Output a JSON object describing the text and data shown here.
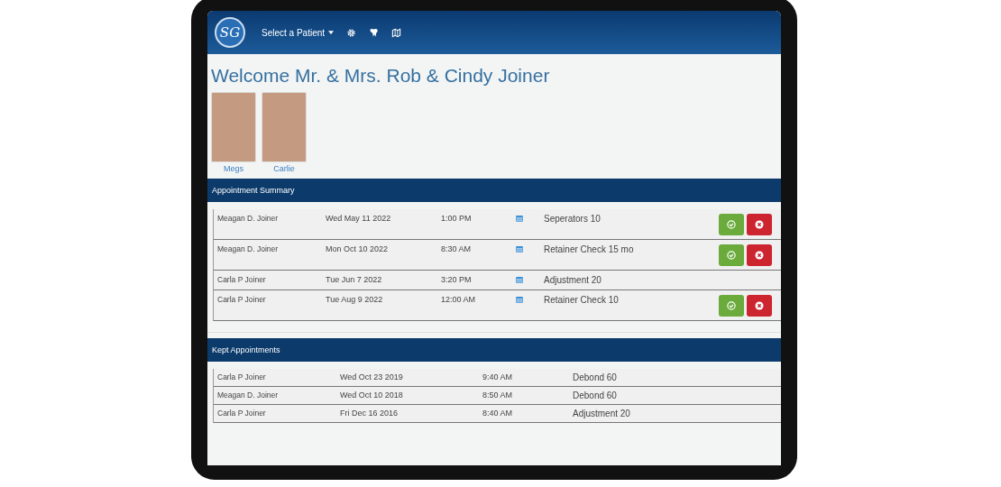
{
  "header": {
    "patient_menu": "Select a Patient",
    "logo": "SG"
  },
  "welcome": "Welcome Mr. & Mrs. Rob & Cindy Joiner",
  "patients": [
    {
      "name": "Megs"
    },
    {
      "name": "Carlie"
    }
  ],
  "appointment_summary": {
    "title": "Appointment Summary",
    "rows": [
      {
        "patient": "Meagan D. Joiner",
        "date": "Wed May 11 2022",
        "time": "1:00 PM",
        "procedure": "Seperators 10",
        "actions": true
      },
      {
        "patient": "Meagan D. Joiner",
        "date": "Mon Oct 10 2022",
        "time": "8:30 AM",
        "procedure": "Retainer Check 15 mo",
        "actions": true
      },
      {
        "patient": "Carla P Joiner",
        "date": "Tue Jun 7 2022",
        "time": "3:20 PM",
        "procedure": "Adjustment 20",
        "actions": false
      },
      {
        "patient": "Carla P Joiner",
        "date": "Tue Aug 9 2022",
        "time": "12:00 AM",
        "procedure": "Retainer Check 10",
        "actions": true
      }
    ]
  },
  "kept_appointments": {
    "title": "Kept Appointments",
    "rows": [
      {
        "patient": "Carla P Joiner",
        "date": "Wed Oct 23 2019",
        "time": "9:40 AM",
        "procedure": "Debond 60"
      },
      {
        "patient": "Meagan D. Joiner",
        "date": "Wed Oct 10 2018",
        "time": "8:50 AM",
        "procedure": "Debond 60"
      },
      {
        "patient": "Carla P Joiner",
        "date": "Fri Dec 16 2016",
        "time": "8:40 AM",
        "procedure": "Adjustment 20"
      }
    ]
  }
}
